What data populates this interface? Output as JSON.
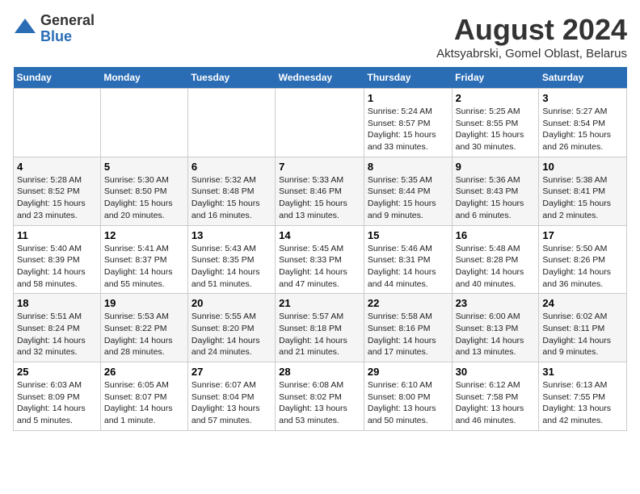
{
  "header": {
    "logo_general": "General",
    "logo_blue": "Blue",
    "month_year": "August 2024",
    "location": "Aktsyabrski, Gomel Oblast, Belarus"
  },
  "weekdays": [
    "Sunday",
    "Monday",
    "Tuesday",
    "Wednesday",
    "Thursday",
    "Friday",
    "Saturday"
  ],
  "weeks": [
    [
      {
        "day": "",
        "text": ""
      },
      {
        "day": "",
        "text": ""
      },
      {
        "day": "",
        "text": ""
      },
      {
        "day": "",
        "text": ""
      },
      {
        "day": "1",
        "text": "Sunrise: 5:24 AM\nSunset: 8:57 PM\nDaylight: 15 hours\nand 33 minutes."
      },
      {
        "day": "2",
        "text": "Sunrise: 5:25 AM\nSunset: 8:55 PM\nDaylight: 15 hours\nand 30 minutes."
      },
      {
        "day": "3",
        "text": "Sunrise: 5:27 AM\nSunset: 8:54 PM\nDaylight: 15 hours\nand 26 minutes."
      }
    ],
    [
      {
        "day": "4",
        "text": "Sunrise: 5:28 AM\nSunset: 8:52 PM\nDaylight: 15 hours\nand 23 minutes."
      },
      {
        "day": "5",
        "text": "Sunrise: 5:30 AM\nSunset: 8:50 PM\nDaylight: 15 hours\nand 20 minutes."
      },
      {
        "day": "6",
        "text": "Sunrise: 5:32 AM\nSunset: 8:48 PM\nDaylight: 15 hours\nand 16 minutes."
      },
      {
        "day": "7",
        "text": "Sunrise: 5:33 AM\nSunset: 8:46 PM\nDaylight: 15 hours\nand 13 minutes."
      },
      {
        "day": "8",
        "text": "Sunrise: 5:35 AM\nSunset: 8:44 PM\nDaylight: 15 hours\nand 9 minutes."
      },
      {
        "day": "9",
        "text": "Sunrise: 5:36 AM\nSunset: 8:43 PM\nDaylight: 15 hours\nand 6 minutes."
      },
      {
        "day": "10",
        "text": "Sunrise: 5:38 AM\nSunset: 8:41 PM\nDaylight: 15 hours\nand 2 minutes."
      }
    ],
    [
      {
        "day": "11",
        "text": "Sunrise: 5:40 AM\nSunset: 8:39 PM\nDaylight: 14 hours\nand 58 minutes."
      },
      {
        "day": "12",
        "text": "Sunrise: 5:41 AM\nSunset: 8:37 PM\nDaylight: 14 hours\nand 55 minutes."
      },
      {
        "day": "13",
        "text": "Sunrise: 5:43 AM\nSunset: 8:35 PM\nDaylight: 14 hours\nand 51 minutes."
      },
      {
        "day": "14",
        "text": "Sunrise: 5:45 AM\nSunset: 8:33 PM\nDaylight: 14 hours\nand 47 minutes."
      },
      {
        "day": "15",
        "text": "Sunrise: 5:46 AM\nSunset: 8:31 PM\nDaylight: 14 hours\nand 44 minutes."
      },
      {
        "day": "16",
        "text": "Sunrise: 5:48 AM\nSunset: 8:28 PM\nDaylight: 14 hours\nand 40 minutes."
      },
      {
        "day": "17",
        "text": "Sunrise: 5:50 AM\nSunset: 8:26 PM\nDaylight: 14 hours\nand 36 minutes."
      }
    ],
    [
      {
        "day": "18",
        "text": "Sunrise: 5:51 AM\nSunset: 8:24 PM\nDaylight: 14 hours\nand 32 minutes."
      },
      {
        "day": "19",
        "text": "Sunrise: 5:53 AM\nSunset: 8:22 PM\nDaylight: 14 hours\nand 28 minutes."
      },
      {
        "day": "20",
        "text": "Sunrise: 5:55 AM\nSunset: 8:20 PM\nDaylight: 14 hours\nand 24 minutes."
      },
      {
        "day": "21",
        "text": "Sunrise: 5:57 AM\nSunset: 8:18 PM\nDaylight: 14 hours\nand 21 minutes."
      },
      {
        "day": "22",
        "text": "Sunrise: 5:58 AM\nSunset: 8:16 PM\nDaylight: 14 hours\nand 17 minutes."
      },
      {
        "day": "23",
        "text": "Sunrise: 6:00 AM\nSunset: 8:13 PM\nDaylight: 14 hours\nand 13 minutes."
      },
      {
        "day": "24",
        "text": "Sunrise: 6:02 AM\nSunset: 8:11 PM\nDaylight: 14 hours\nand 9 minutes."
      }
    ],
    [
      {
        "day": "25",
        "text": "Sunrise: 6:03 AM\nSunset: 8:09 PM\nDaylight: 14 hours\nand 5 minutes."
      },
      {
        "day": "26",
        "text": "Sunrise: 6:05 AM\nSunset: 8:07 PM\nDaylight: 14 hours\nand 1 minute."
      },
      {
        "day": "27",
        "text": "Sunrise: 6:07 AM\nSunset: 8:04 PM\nDaylight: 13 hours\nand 57 minutes."
      },
      {
        "day": "28",
        "text": "Sunrise: 6:08 AM\nSunset: 8:02 PM\nDaylight: 13 hours\nand 53 minutes."
      },
      {
        "day": "29",
        "text": "Sunrise: 6:10 AM\nSunset: 8:00 PM\nDaylight: 13 hours\nand 50 minutes."
      },
      {
        "day": "30",
        "text": "Sunrise: 6:12 AM\nSunset: 7:58 PM\nDaylight: 13 hours\nand 46 minutes."
      },
      {
        "day": "31",
        "text": "Sunrise: 6:13 AM\nSunset: 7:55 PM\nDaylight: 13 hours\nand 42 minutes."
      }
    ]
  ]
}
